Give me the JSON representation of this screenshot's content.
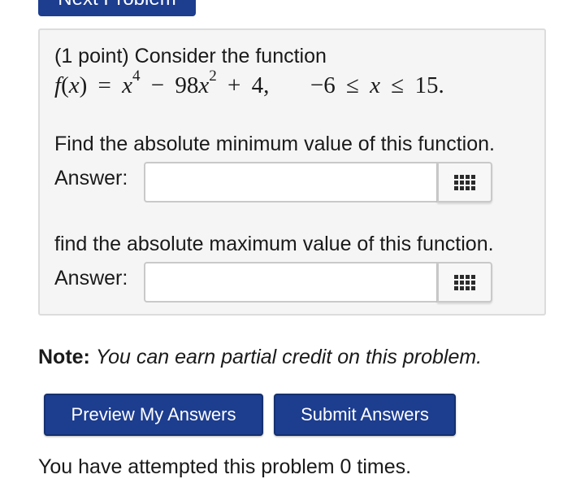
{
  "top_button": {
    "label": "Next Problem"
  },
  "problem": {
    "intro": "(1 point) Consider the function",
    "formula": {
      "lhs_func": "f",
      "lhs_paren_open": "(",
      "lhs_var": "x",
      "lhs_paren_close": ")",
      "eq": "=",
      "t1_var": "x",
      "t1_exp": "4",
      "minus": "−",
      "t2_coef": "98",
      "t2_var": "x",
      "t2_exp": "2",
      "plus": "+",
      "t3_const": "4,",
      "domain_low": "−6",
      "le1": "≤",
      "domain_var": "x",
      "le2": "≤",
      "domain_high": "15."
    },
    "question_min": "Find the absolute minimum value of this function.",
    "question_max": "find the absolute maximum value of this function.",
    "answer_label": "Answer:",
    "answer_min_value": "",
    "answer_max_value": ""
  },
  "note": {
    "bold": "Note:",
    "italic": "You can earn partial credit on this problem."
  },
  "buttons": {
    "preview": "Preview My Answers",
    "submit": "Submit Answers"
  },
  "attempts_text": "You have attempted this problem 0 times.",
  "colors": {
    "button_bg": "#1d3d8f",
    "panel_bg": "#f5f5f5"
  }
}
